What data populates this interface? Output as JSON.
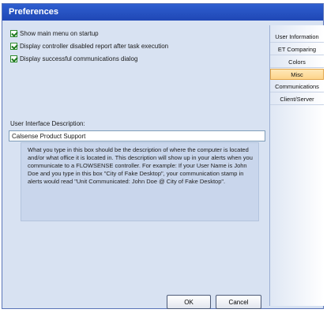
{
  "window": {
    "title": "Preferences"
  },
  "options": [
    {
      "label": "Show main menu on startup",
      "checked": true
    },
    {
      "label": "Display controller disabled report after task execution",
      "checked": true
    },
    {
      "label": "Display successful communications dialog",
      "checked": true
    }
  ],
  "description": {
    "label": "User Interface Description:",
    "value": "Calsense Product Support",
    "help": "What you type in this box should be the description of where the computer is located and/or what office it is located in.  This description will show up in your alerts when you communicate to a FLOWSENSE controller.  For example: If your User Name is John Doe and you type in this box \"City of Fake Desktop\", your communication stamp in alerts would read \"Unit Communicated: John Doe @ City of Fake Desktop\"."
  },
  "buttons": {
    "ok": "OK",
    "cancel": "Cancel"
  },
  "sidebar": {
    "items": [
      {
        "label": "User Information",
        "active": false
      },
      {
        "label": "ET Comparing",
        "active": false
      },
      {
        "label": "Colors",
        "active": false
      },
      {
        "label": "Misc",
        "active": true
      },
      {
        "label": "Communications",
        "active": false
      },
      {
        "label": "Client/Server",
        "active": false
      }
    ]
  },
  "colors": {
    "titlebar": "#2352c4",
    "panel": "#d8e2f2",
    "active_tab": "#fdd48b"
  }
}
